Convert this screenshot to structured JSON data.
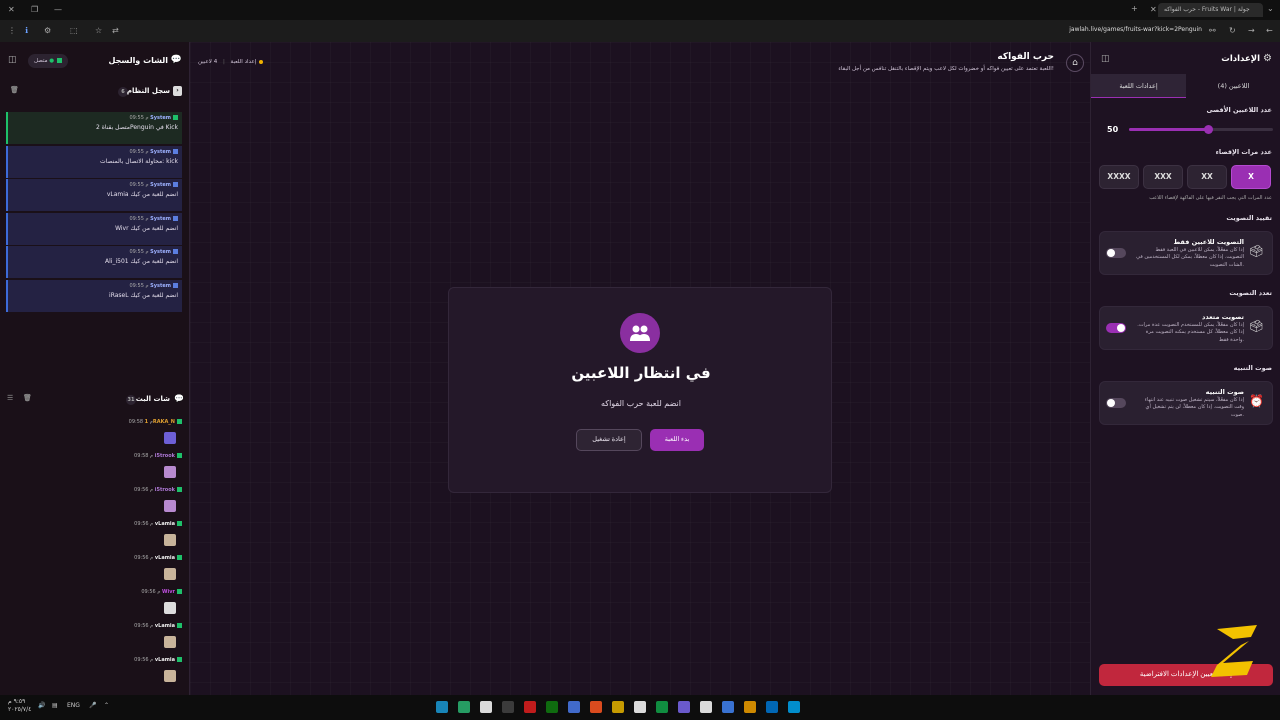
{
  "browser": {
    "tab_title": "حرب الفواكه - Fruits War | جولة",
    "url": "jawlah.live/games/fruits-war?kick=2Penguin"
  },
  "center": {
    "game_title": "حرب الفواكه",
    "game_subtitle": "اللعبة تعتمد على تعيين فواكه أو خضروات لكل لاعب ويتم الإقصاء بالتنقل تنافس من أجل البقاء!",
    "players_status": "4 لاعبين",
    "setup_status": "إعداد اللعبة",
    "waiting_title": "في انتظار اللاعبين",
    "waiting_subtitle": "انضم للعبة حرب الفواكه",
    "start_button": "بدء اللعبة",
    "restart_button": "إعادة تشغيل"
  },
  "left": {
    "title": "الشات والسجل",
    "connection": "متصل",
    "system_log": {
      "title": "سجل النظام",
      "count": "6",
      "entries": [
        {
          "sender": "System",
          "time": "09:55 م",
          "text": "متصل بقناة 2Penguin في Kick",
          "kind": "ok"
        },
        {
          "sender": "System",
          "time": "09:55 م",
          "text": "محاولة الاتصال بالمنصات: kick",
          "kind": "info"
        },
        {
          "sender": "System",
          "time": "09:55 م",
          "text": "vLamia انضم للعبة من كيك",
          "kind": "info"
        },
        {
          "sender": "System",
          "time": "09:55 م",
          "text": "Wivr انضم للعبة من كيك",
          "kind": "info"
        },
        {
          "sender": "System",
          "time": "09:55 م",
          "text": "Ali_i501 انضم للعبة من كيك",
          "kind": "info"
        },
        {
          "sender": "System",
          "time": "09:55 م",
          "text": "iRaseL انضم للعبة من كيك",
          "kind": "info"
        }
      ]
    },
    "stream_chat": {
      "title": "شات البث",
      "count": "31",
      "messages": [
        {
          "user": "1RAKA_N",
          "time": "09:58 م",
          "color": "#e0a030",
          "emote": "#6d5fd6"
        },
        {
          "user": "i5trook",
          "time": "09:58 م",
          "color": "#b07ad8",
          "emote": "#b88ad0"
        },
        {
          "user": "i5trook",
          "time": "09:56 م",
          "color": "#b07ad8",
          "emote": "#b88ad0"
        },
        {
          "user": "vLamia",
          "time": "09:56 م",
          "color": "#f0f0f0",
          "emote": "#c8b49a"
        },
        {
          "user": "vLamia",
          "time": "09:56 م",
          "color": "#f0f0f0",
          "emote": "#c8b49a"
        },
        {
          "user": "Wivr",
          "time": "09:56 م",
          "color": "#c050e0",
          "emote": "#dddddd"
        },
        {
          "user": "vLamia",
          "time": "09:56 م",
          "color": "#f0f0f0",
          "emote": "#c8b49a"
        },
        {
          "user": "vLamia",
          "time": "09:56 م",
          "color": "#f0f0f0",
          "emote": "#c8b49a"
        }
      ]
    }
  },
  "right": {
    "title": "الإعدادات",
    "tabs": [
      "اللاعبين (4)",
      "إعدادات اللعبة"
    ],
    "max_players_label": "عدد اللاعبين الأقصى",
    "max_players_value": "50",
    "max_players_fraction": 0.55,
    "elimination_label": "عدد مرات الإقصاء",
    "elimination_options": [
      "X",
      "XX",
      "XXX",
      "XXXX"
    ],
    "elimination_hint": "عدد المرات التي يجب النقر فيها على الفاكهة لإقصاء اللاعب",
    "vote_restrict_label": "تقييد التصويت",
    "vote_restrict_card": {
      "title": "التصويت للاعبين فقط",
      "desc": "إذا كان مفعّلاً، يمكن للاعبين في اللعبة فقط التصويت. إذا كان معطلاً، يمكن لكل المستخدمين في الشات التصويت.",
      "on": false
    },
    "multi_vote_label": "تعدد التصويت",
    "multi_vote_card": {
      "title": "تصويت متعدد",
      "desc": "إذا كان مفعّلاً، يمكن للمستخدم التصويت عدة مرات. إذا كان معطلاً، كل مستخدم يمكنه التصويت مرة واحدة فقط.",
      "on": true
    },
    "alert_sound_label": "صوت التنبيه",
    "alert_sound_card": {
      "title": "صوت التنبيه",
      "desc": "إذا كان مفعّلاً، سيتم تشغيل صوت تنبيه عند انتهاء وقت التصويت. إذا كان معطلاً، لن يتم تشغيل أي صوت.",
      "on": false
    },
    "reset_defaults": "إعادة تعيين الإعدادات الافتراضية"
  },
  "taskbar": {
    "language": "ENG",
    "time": "٩:٥٩ م",
    "date": "٢٠٢٥/٧/٤"
  },
  "colors": {
    "accent": "#9a2fb3",
    "danger": "#c1273d",
    "online": "#1ec06a"
  }
}
